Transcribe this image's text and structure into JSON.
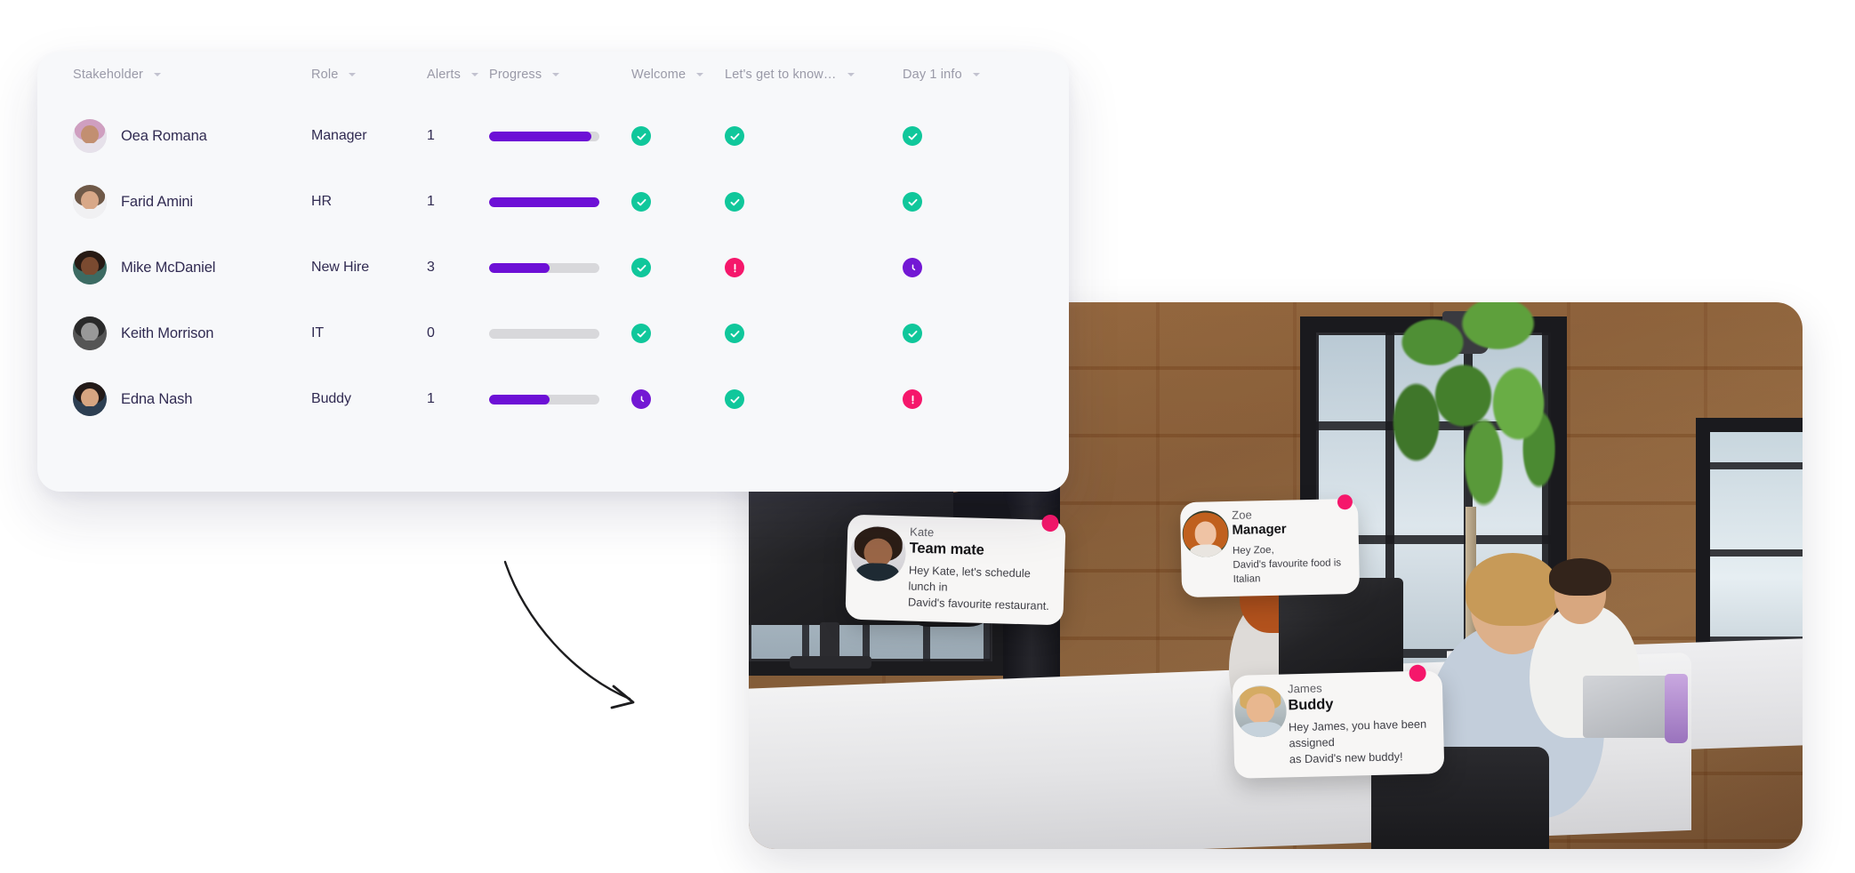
{
  "panel": {
    "columns": [
      {
        "key": "stakeholder",
        "label": "Stakeholder",
        "sortable": true
      },
      {
        "key": "role",
        "label": "Role",
        "sortable": true
      },
      {
        "key": "alerts",
        "label": "Alerts",
        "sortable": true
      },
      {
        "key": "progress",
        "label": "Progress",
        "sortable": true
      },
      {
        "key": "welcome",
        "label": "Welcome",
        "sortable": true
      },
      {
        "key": "know",
        "label": "Let's get to know…",
        "sortable": true
      },
      {
        "key": "day1",
        "label": "Day 1 info",
        "sortable": true
      }
    ],
    "rows": [
      {
        "name": "Oea Romana",
        "role": "Manager",
        "alerts": "1",
        "progress": 93,
        "welcome": "done",
        "know": "done",
        "day1": "done",
        "avatar": {
          "skin": "#c28f71",
          "hair": "#cf9fc0",
          "shirt": "#e6e1ea"
        }
      },
      {
        "name": "Farid Amini",
        "role": "HR",
        "alerts": "1",
        "progress": 100,
        "welcome": "done",
        "know": "done",
        "day1": "done",
        "avatar": {
          "skin": "#d8a888",
          "hair": "#6f5948",
          "shirt": "#f0f0f2"
        }
      },
      {
        "name": "Mike McDaniel",
        "role": "New Hire",
        "alerts": "3",
        "progress": 55,
        "welcome": "done",
        "know": "alert",
        "day1": "wait",
        "avatar": {
          "skin": "#7a4a30",
          "hair": "#271a14",
          "shirt": "#3c6b63"
        }
      },
      {
        "name": "Keith Morrison",
        "role": "IT",
        "alerts": "0",
        "progress": 0,
        "welcome": "done",
        "know": "done",
        "day1": "done",
        "avatar": {
          "skin": "#999999",
          "hair": "#2a2a2a",
          "shirt": "#555555"
        }
      },
      {
        "name": "Edna Nash",
        "role": "Buddy",
        "alerts": "1",
        "progress": 55,
        "welcome": "wait",
        "know": "done",
        "day1": "alert",
        "avatar": {
          "skin": "#d6a581",
          "hair": "#221a18",
          "shirt": "#2d3f52"
        }
      }
    ],
    "status_legend": {
      "done": {
        "icon": "check-circle-icon",
        "color": "#10c79b"
      },
      "alert": {
        "icon": "alert-circle-icon",
        "color": "#f5176b"
      },
      "wait": {
        "icon": "clock-circle-icon",
        "color": "#7318d4"
      }
    },
    "progress_colors": {
      "fill": "#6d10d6",
      "track": "#d8d8db"
    }
  },
  "cards": [
    {
      "id": "kate",
      "name": "Kate",
      "role": "Team mate",
      "message": "Hey Kate, let's schedule lunch in\nDavid's favourite restaurant.",
      "badge_color": "#f5176b"
    },
    {
      "id": "zoe",
      "name": "Zoe",
      "role": "Manager",
      "message": "Hey Zoe,\nDavid's favourite food is Italian",
      "badge_color": "#f5176b"
    },
    {
      "id": "james",
      "name": "James",
      "role": "Buddy",
      "message": "Hey James, you have been assigned\nas David's new buddy!",
      "badge_color": "#f5176b"
    }
  ],
  "photo": {
    "alt": "office-workspace-photo"
  },
  "arrow": {
    "name": "curved-arrow-annotation",
    "color": "#1d1d1f"
  }
}
